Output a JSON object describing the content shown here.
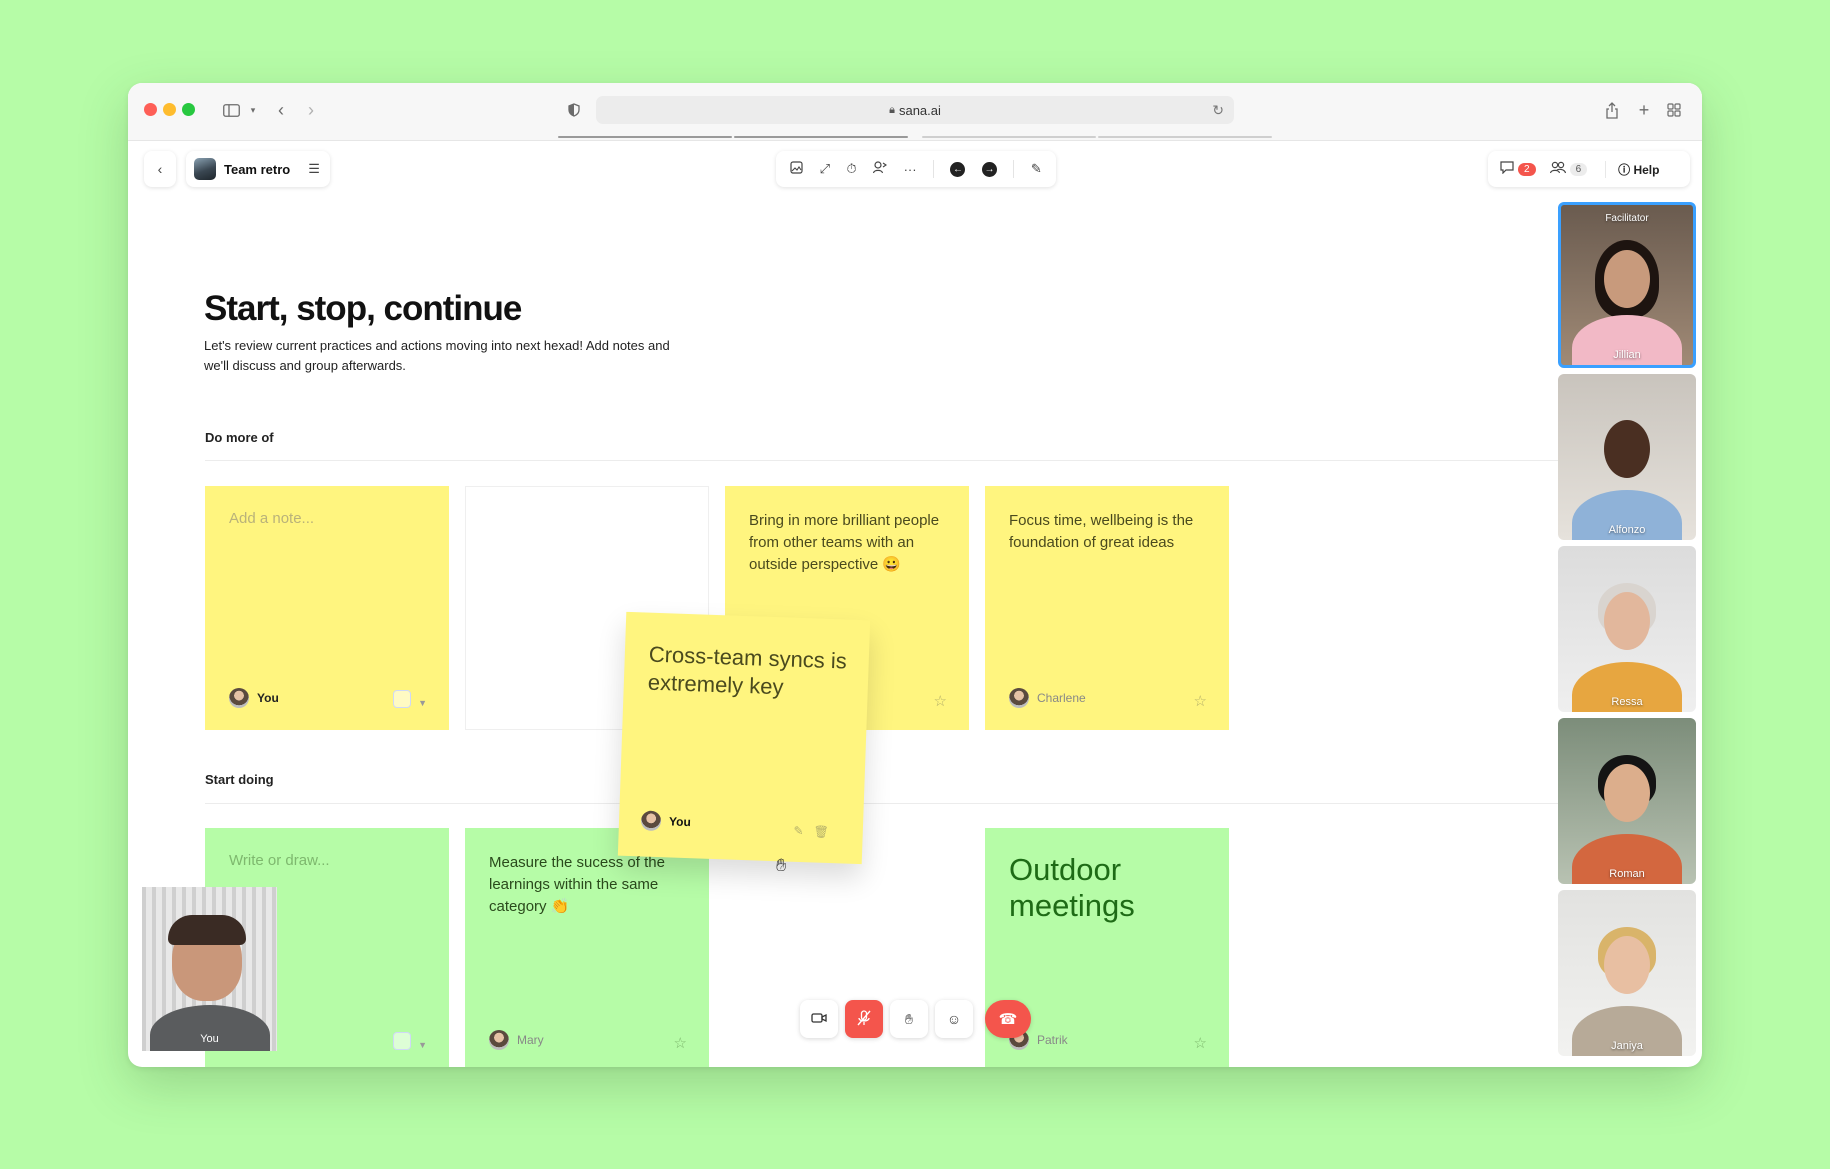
{
  "browser": {
    "url": "sana.ai"
  },
  "topbar": {
    "back_icon": "‹",
    "board_title": "Team retro",
    "comments_count": "2",
    "participants_count": "6",
    "help_label": "Help"
  },
  "page": {
    "title": "Start, stop, continue",
    "description": "Let's review current practices and actions moving into next hexad! Add notes and we'll discuss and group afterwards."
  },
  "sections": [
    {
      "label": "Do more of",
      "notes": [
        {
          "placeholder": "Add a note...",
          "author": "You",
          "color": "yellow"
        },
        {
          "text": "",
          "color": "blank"
        },
        {
          "text": "Bring in more brilliant people from other teams with an outside perspective 😀",
          "author": "",
          "color": "yellow"
        },
        {
          "text": "Focus time, wellbeing is the foundation of great ideas",
          "author": "Charlene",
          "color": "yellow"
        }
      ]
    },
    {
      "label": "Start doing",
      "notes": [
        {
          "placeholder": "Write or draw...",
          "color": "green"
        },
        {
          "text": "Measure the sucess of the learnings within the same category 👏",
          "author": "Mary",
          "color": "green"
        },
        {
          "text": "Outdoor meetings",
          "author": "Patrik",
          "color": "green"
        }
      ]
    }
  ],
  "dragged_note": {
    "text": "Cross-team syncs is extremely key",
    "author": "You"
  },
  "participants": [
    {
      "name": "Jillian",
      "role": "Facilitator"
    },
    {
      "name": "Alfonzo"
    },
    {
      "name": "Ressa"
    },
    {
      "name": "Roman"
    },
    {
      "name": "Janiya"
    }
  ],
  "self_view": {
    "label": "You"
  },
  "colors": {
    "background": "#b6fca7",
    "note_yellow": "#fff57f",
    "note_green": "#b6fca7",
    "danger": "#f4554c",
    "facilitator_border": "#3aa0ff"
  }
}
